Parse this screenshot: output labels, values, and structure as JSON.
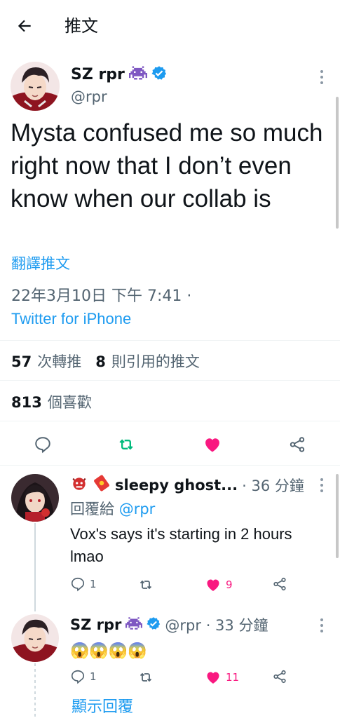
{
  "header": {
    "title": "推文",
    "back_icon": "arrow-left-icon"
  },
  "main_tweet": {
    "name": "SZ rpr",
    "handle": "@rpr",
    "text": "Mysta confused me so much right now that I don’t even know when our collab is",
    "translate": "翻譯推文",
    "timestamp": "22年3月10日 下午 7:41 ·",
    "client": "Twitter for iPhone",
    "retweets_num": "57",
    "retweets_label": "次轉推",
    "quotes_num": "8",
    "quotes_label": "則引用的推文",
    "likes_num": "813",
    "likes_label": "個喜歡",
    "colors": {
      "like": "#f91880",
      "retweet": "#00ba7c",
      "link": "#1d9bf0",
      "verified": "#1d9bf0"
    }
  },
  "replies": [
    {
      "name": "sleepy ghost...",
      "meta": "· 36 分鐘",
      "reply_to_prefix": "回覆給",
      "reply_to_handle": "@rpr",
      "text": "Vox's says it's starting in 2 hours lmao",
      "reply_count": "1",
      "retweet_count": "",
      "like_count": "9"
    },
    {
      "name": "SZ rpr",
      "meta": "@rpr · 33 分鐘",
      "text": "😱😱😱😱",
      "reply_count": "1",
      "retweet_count": "",
      "like_count": "11"
    }
  ],
  "show_replies": "顯示回覆"
}
